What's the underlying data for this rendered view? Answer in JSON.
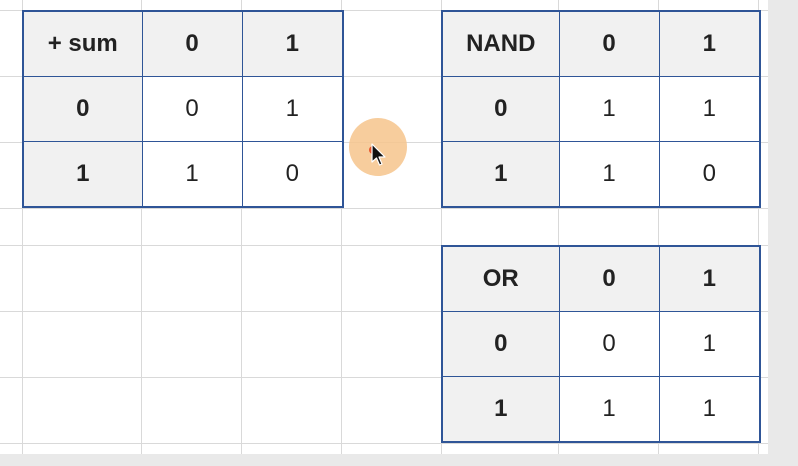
{
  "tables": {
    "sum": {
      "header": [
        "+ sum",
        "0",
        "1"
      ],
      "rows": [
        [
          "0",
          "0",
          "1"
        ],
        [
          "1",
          "1",
          "0"
        ]
      ]
    },
    "nand": {
      "header": [
        "NAND",
        "0",
        "1"
      ],
      "rows": [
        [
          "0",
          "1",
          "1"
        ],
        [
          "1",
          "1",
          "0"
        ]
      ]
    },
    "or": {
      "header": [
        "OR",
        "0",
        "1"
      ],
      "rows": [
        [
          "0",
          "0",
          "1"
        ],
        [
          "1",
          "1",
          "1"
        ]
      ]
    }
  },
  "colors": {
    "table_border": "#2f5597",
    "header_fill": "#f1f1f1",
    "gridline": "#d9d9d9",
    "cursor_highlight": "#f6c48c",
    "click_dot": "#e8542a"
  },
  "cursor": {
    "icon": "arrow-pointer-icon"
  }
}
